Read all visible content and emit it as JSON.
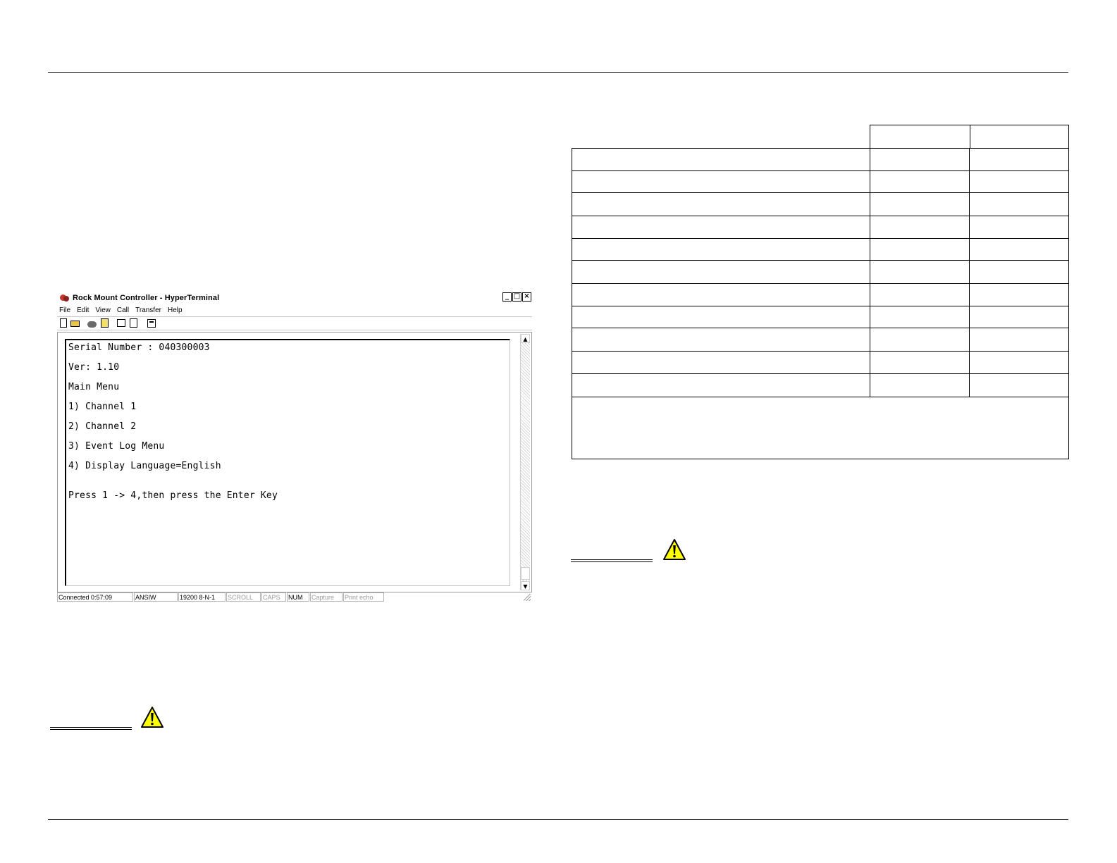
{
  "window": {
    "title": "Rock Mount Controller - HyperTerminal",
    "controls": {
      "minimize": "_",
      "maximize": "□",
      "close": "×"
    },
    "menu": [
      "File",
      "Edit",
      "View",
      "Call",
      "Transfer",
      "Help"
    ],
    "toolbar_icons": [
      "new-document-icon",
      "open-folder-icon",
      "connect-icon",
      "disconnect-icon",
      "send-icon",
      "receive-icon",
      "properties-icon"
    ],
    "terminal_lines": [
      "Serial Number : 040300003",
      "Ver: 1.10",
      "Main Menu",
      "1) Channel 1",
      "2) Channel 2",
      "3) Event Log Menu",
      "4) Display Language=English",
      "Press 1 -> 4,then press the Enter Key"
    ],
    "scrollbar": {
      "up": "▲",
      "down": "▼"
    },
    "status": {
      "connected": "Connected 0:57:09",
      "emulation": "ANSIW",
      "settings": "19200 8-N-1",
      "scroll": "SCROLL",
      "caps": "CAPS",
      "num": "NUM",
      "capture": "Capture",
      "print_echo": "Print echo"
    }
  },
  "caution_icon": "warning-triangle-icon",
  "colors": {
    "warning_fill": "#ffff00",
    "rule": "#000000"
  }
}
